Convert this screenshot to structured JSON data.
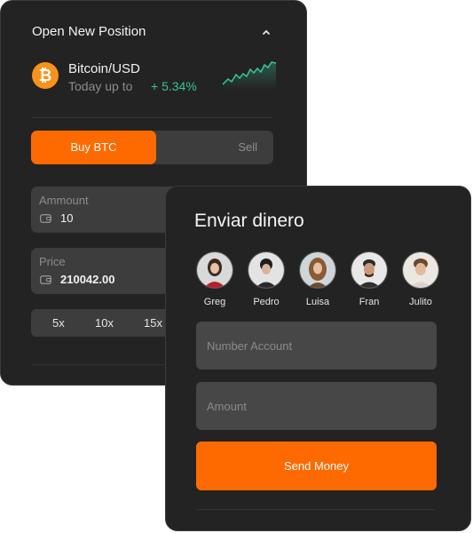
{
  "position_card": {
    "title": "Open New Position",
    "pair": "Bitcoin/USD",
    "today_label": "Today up to",
    "change": "+ 5.34%",
    "buy_label": "Buy BTC",
    "sell_label": "Sell",
    "amount": {
      "label": "Ammount",
      "value": "10"
    },
    "price": {
      "label": "Price",
      "value": "210042.00"
    },
    "leverage": [
      "5x",
      "10x",
      "15x"
    ]
  },
  "send_card": {
    "title": "Enviar dinero",
    "contacts": [
      {
        "name": "Greg"
      },
      {
        "name": "Pedro"
      },
      {
        "name": "Luisa"
      },
      {
        "name": "Fran"
      },
      {
        "name": "Julito"
      }
    ],
    "account_placeholder": "Number Account",
    "amount_placeholder": "Amount",
    "send_label": "Send Money"
  },
  "colors": {
    "accent": "#ff6a00",
    "positive": "#38c49a",
    "card": "#232323",
    "field": "#3d3d3d"
  }
}
